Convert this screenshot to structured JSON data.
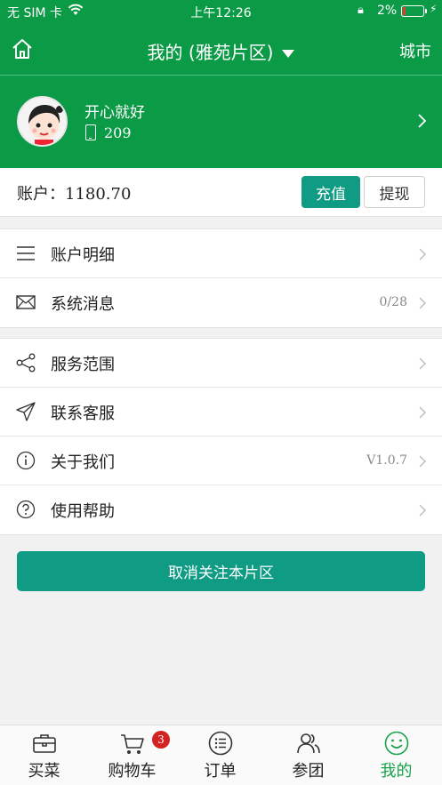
{
  "status_bar": {
    "carrier": "无 SIM 卡",
    "time": "上午12:26",
    "battery_percent": "2%"
  },
  "navbar": {
    "title": "我的 (雅苑片区)",
    "city_label": "城市"
  },
  "profile": {
    "name": "开心就好",
    "phone": "209"
  },
  "account": {
    "label": "账户：",
    "balance": "1180.70",
    "recharge_label": "充值",
    "withdraw_label": "提现"
  },
  "menu_group_1": [
    {
      "label": "账户明细",
      "icon": "list-icon",
      "extra": ""
    },
    {
      "label": "系统消息",
      "icon": "mail-icon",
      "extra": "0/28"
    }
  ],
  "menu_group_2": [
    {
      "label": "服务范围",
      "icon": "share-icon",
      "extra": ""
    },
    {
      "label": "联系客服",
      "icon": "send-icon",
      "extra": ""
    },
    {
      "label": "关于我们",
      "icon": "info-icon",
      "extra": "V1.0.7"
    },
    {
      "label": "使用帮助",
      "icon": "help-icon",
      "extra": ""
    }
  ],
  "unfollow_label": "取消关注本片区",
  "tabs": [
    {
      "label": "买菜",
      "icon": "briefcase-icon",
      "active": false
    },
    {
      "label": "购物车",
      "icon": "cart-icon",
      "active": false,
      "badge": "3"
    },
    {
      "label": "订单",
      "icon": "order-list-icon",
      "active": false
    },
    {
      "label": "参团",
      "icon": "group-icon",
      "active": false
    },
    {
      "label": "我的",
      "icon": "smile-icon",
      "active": true
    }
  ],
  "colors": {
    "primary_green": "#0b9a45",
    "button_teal": "#0f9b84",
    "active_tab": "#16a34a",
    "badge_red": "#d32222"
  }
}
